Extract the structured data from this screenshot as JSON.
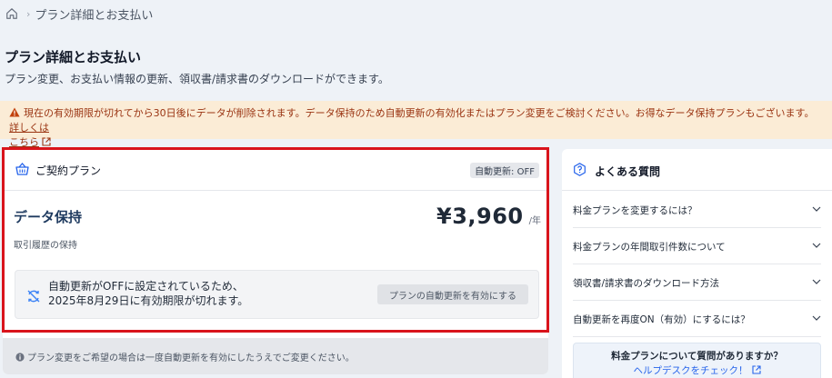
{
  "breadcrumb": {
    "current": "プラン詳細とお支払い"
  },
  "page": {
    "title": "プラン詳細とお支払い",
    "description": "プラン変更、お支払い情報の更新、領収書/請求書のダウンロードができます。"
  },
  "alert": {
    "message": "現在の有効期限が切れてから30日後にデータが削除されます。データ保持のため自動更新の有効化またはプラン変更をご検討ください。お得なデータ保持プランもございます。",
    "link_line1": "詳しくは",
    "link_line2": "こちら"
  },
  "contract": {
    "header_label": "ご契約プラン",
    "auto_renew_badge": "自動更新: OFF",
    "plan_name": "データ保持",
    "plan_description": "取引履歴の保持",
    "price": "¥3,960",
    "price_unit": "/年",
    "notice_line1": "自動更新がOFFに設定されているため、",
    "notice_line2": "2025年8月29日に有効期限が切れます。",
    "enable_button": "プランの自動更新を有効にする",
    "footer_note": "プラン変更をご希望の場合は一度自動更新を有効にしたうえでご変更ください。"
  },
  "faq": {
    "title": "よくある質問",
    "items": [
      {
        "label": "料金プランを変更するには？"
      },
      {
        "label": "料金プランの年間取引件数について"
      },
      {
        "label": "領収書/請求書のダウンロード方法"
      },
      {
        "label": "自動更新を再度ON（有効）にするには？"
      }
    ],
    "help_question": "料金プランについて質問がありますか？",
    "help_link": "ヘルプデスクをチェック！"
  },
  "colors": {
    "accent_red": "#d9141c",
    "warning_bg": "#fbecd6",
    "warning_text": "#9a3412",
    "plan_name": "#1e3a5f",
    "link": "#2563eb"
  }
}
